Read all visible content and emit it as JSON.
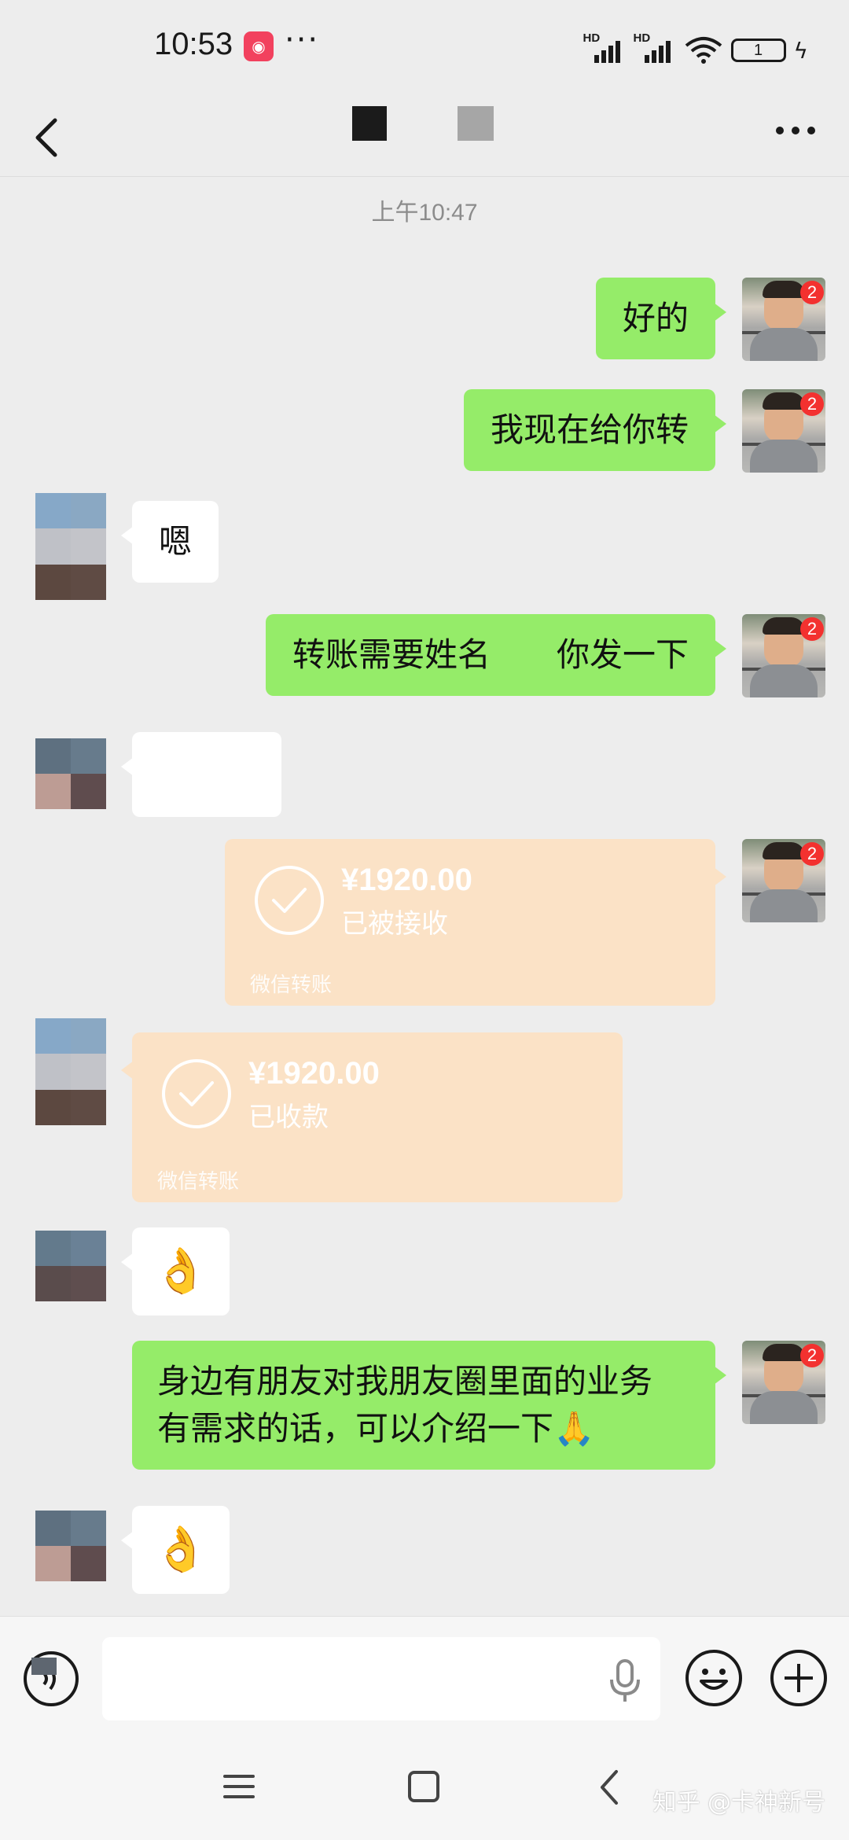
{
  "status_bar": {
    "time": "10:53",
    "more": "···",
    "battery_level": "1",
    "signal1_label": "HD",
    "signal2_label": "HD"
  },
  "nav": {
    "back_icon": "chevron-left-icon",
    "more_icon": "more-dots-icon"
  },
  "chat": {
    "timestamp": "上午10:47",
    "messages": [
      {
        "from": "me",
        "type": "text",
        "text": "好的"
      },
      {
        "from": "me",
        "type": "text",
        "text": "我现在给你转"
      },
      {
        "from": "other",
        "type": "text",
        "text": "嗯"
      },
      {
        "from": "me",
        "type": "text",
        "text": "转账需要姓名　　你发一下"
      },
      {
        "from": "other",
        "type": "text",
        "text": ""
      },
      {
        "from": "me",
        "type": "transfer",
        "amount": "¥1920.00",
        "status": "已被接收",
        "footer": "微信转账"
      },
      {
        "from": "other",
        "type": "transfer",
        "amount": "¥1920.00",
        "status": "已收款",
        "footer": "微信转账"
      },
      {
        "from": "other",
        "type": "emoji",
        "emoji": "👌"
      },
      {
        "from": "me",
        "type": "text",
        "line1": "身边有朋友对我朋友圈里面的业务",
        "line2": "有需求的话，可以介绍一下",
        "emoji": "🙏"
      },
      {
        "from": "other",
        "type": "emoji",
        "emoji": "👌"
      }
    ],
    "my_avatar_badge": "2"
  },
  "input_bar": {
    "value": "",
    "placeholder": ""
  },
  "watermark": "知乎 @卡神新号",
  "colors": {
    "my_bubble": "#95ec69",
    "other_bubble": "#ffffff",
    "transfer_bubble": "#fbe2c6",
    "background": "#ededed",
    "badge": "#f3312f"
  }
}
